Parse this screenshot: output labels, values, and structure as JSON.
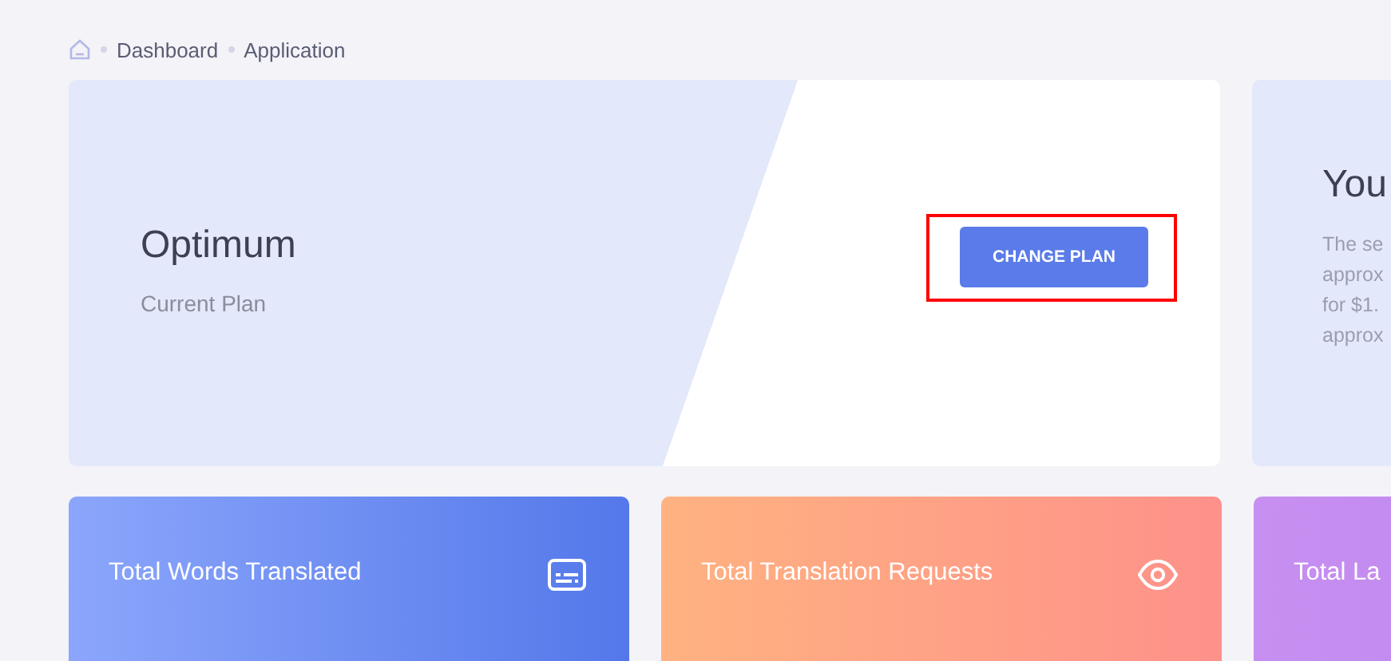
{
  "breadcrumb": {
    "items": [
      {
        "label": "Dashboard"
      },
      {
        "label": "Application"
      }
    ]
  },
  "plan": {
    "name": "Optimum",
    "caption": "Current Plan",
    "button": "CHANGE PLAN",
    "highlighted": true
  },
  "info_card": {
    "title": "You",
    "lines": [
      "The se",
      "approx",
      "for $1.",
      "approx"
    ]
  },
  "stats": [
    {
      "title": "Total Words Translated"
    },
    {
      "title": "Total Translation Requests"
    },
    {
      "title": "Total La"
    }
  ]
}
